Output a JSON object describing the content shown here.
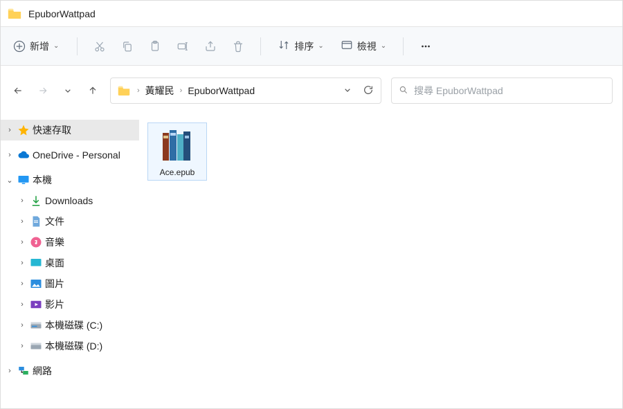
{
  "window": {
    "title": "EpuborWattpad"
  },
  "ribbon": {
    "new_label": "新增",
    "sort_label": "排序",
    "view_label": "檢視"
  },
  "breadcrumb": {
    "items": [
      "黃耀民",
      "EpuborWattpad"
    ]
  },
  "search": {
    "placeholder": "搜尋 EpuborWattpad"
  },
  "sidebar": {
    "quick_access": "快速存取",
    "onedrive": "OneDrive - Personal",
    "this_pc": "本機",
    "downloads": "Downloads",
    "documents": "文件",
    "music": "音樂",
    "desktop": "桌面",
    "pictures": "圖片",
    "videos": "影片",
    "drive_c": "本機磁碟 (C:)",
    "drive_d": "本機磁碟 (D:)",
    "network": "網路"
  },
  "files": {
    "0": {
      "name": "Ace.epub"
    }
  }
}
